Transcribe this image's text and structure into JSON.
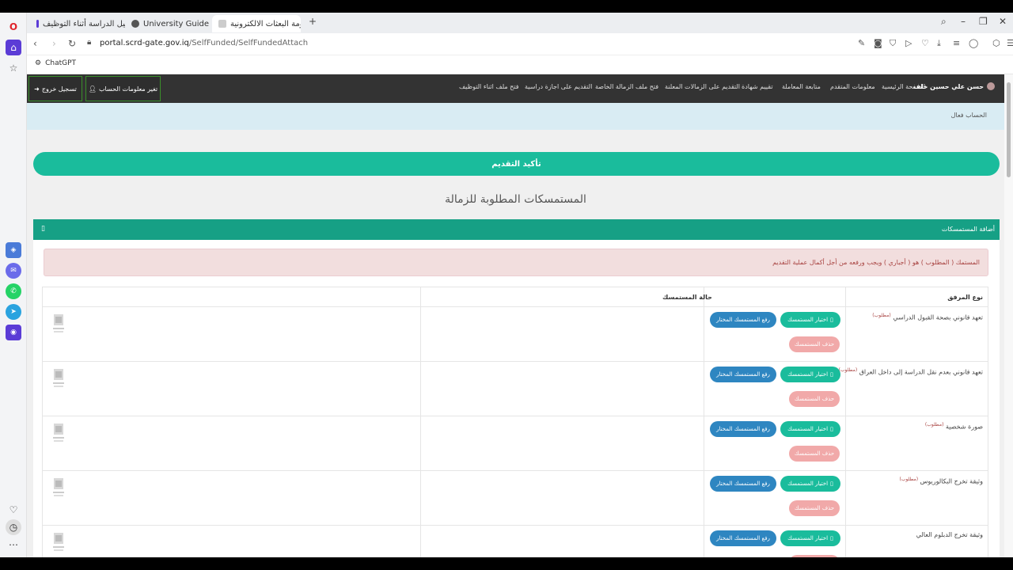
{
  "browser": {
    "tabs": [
      {
        "title": "دليل الدراسة أثناء التوظيف",
        "active": false
      },
      {
        "title": "University Guide",
        "active": false
      },
      {
        "title": "منظومة البعثات الالكترونية",
        "active": true
      }
    ],
    "url_host": "portal.scrd-gate.gov.iq",
    "url_path": "/SelfFunded/SelfFundedAttach",
    "bookmark": "ChatGPT"
  },
  "navbar": {
    "user": "حسن علي حسين خلف",
    "links": [
      "الصفحة الرئيسية",
      "معلومات المتقدم",
      "متابعة المعاملة",
      "تقييم شهادة",
      "التقديم على الزمالات المعلنة",
      "فتح ملف الزمالة الخاصة",
      "التقديم على اجازة دراسية",
      "فتح ملف اثناء التوظيف"
    ],
    "account_button": "تغير معلومات الحساب",
    "logout_button": "تسجيل خروج"
  },
  "breadcrumb": "الحساب فعال",
  "confirm_button": "تأكيد التقديم",
  "page_title": "المستمسكات المطلوبة للزمالة",
  "panel": {
    "title": "أضافة المستمسكات",
    "icon": "square-icon"
  },
  "alert": "المستمك ( المطلوب ) هو ( أجباري ) ويجب ورفعه من أجل أكمال عملية التقديم",
  "table": {
    "headers": {
      "type": "نوع المرفق",
      "status": "حالة المستمسك"
    },
    "required_label": "(مطلوب)",
    "choose_label": "اختيار المستمسك",
    "upload_label": "رفع المستمسك المختار",
    "delete_label": "حذف المستمسك",
    "rows": [
      {
        "name": "تعهد قانوني بصحة القبول الدراسي",
        "required": true
      },
      {
        "name": "تعهد قانوني بعدم نقل الدراسة إلى داخل العراق",
        "required": true
      },
      {
        "name": "صورة شخصية",
        "required": true
      },
      {
        "name": "وثيقة تخرج البكالوريوس",
        "required": true
      },
      {
        "name": "وثيقة تخرج الدبلوم العالي",
        "required": false
      }
    ]
  },
  "colors": {
    "teal": "#1abc9c",
    "dark_teal": "#16a085",
    "blue": "#2e86c1",
    "navbar": "#333333",
    "alert_bg": "#f2dede"
  }
}
